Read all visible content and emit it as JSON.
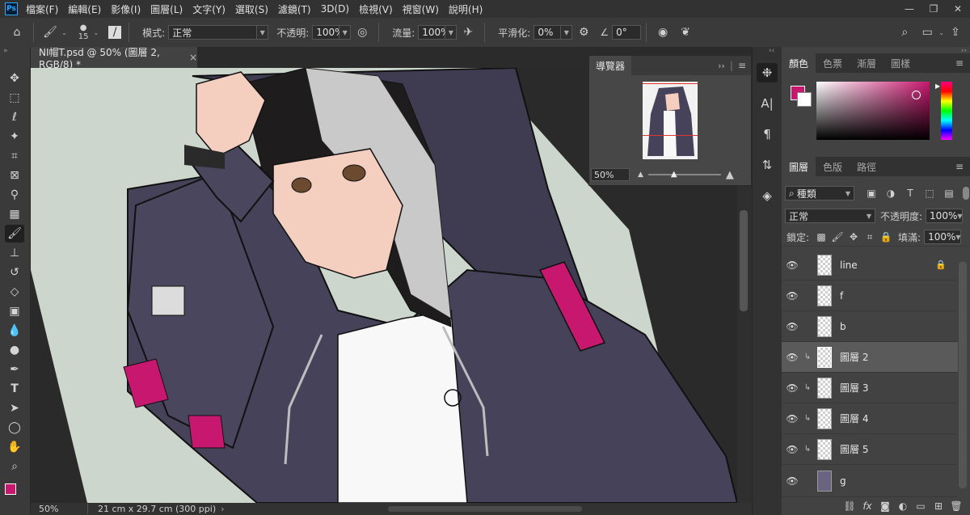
{
  "menu": {
    "app_badge": "Ps",
    "items": [
      "檔案(F)",
      "編輯(E)",
      "影像(I)",
      "圖層(L)",
      "文字(Y)",
      "選取(S)",
      "濾鏡(T)",
      "3D(D)",
      "檢視(V)",
      "視窗(W)",
      "說明(H)"
    ]
  },
  "options": {
    "brush_size": "15",
    "mode_label": "模式:",
    "mode_value": "正常",
    "opacity_label": "不透明:",
    "opacity_value": "100%",
    "flow_label": "流量:",
    "flow_value": "100%",
    "smoothing_label": "平滑化:",
    "smoothing_value": "0%",
    "angle_value": "0°"
  },
  "document": {
    "tab_title": "NI帽T.psd @ 50% (圖層 2, RGB/8) *",
    "zoom": "50%",
    "doc_info": "21 cm x 29.7 cm (300 ppi)"
  },
  "navigator": {
    "title": "導覽器",
    "zoom": "50%"
  },
  "color_panel": {
    "tabs": [
      "顏色",
      "色票",
      "漸層",
      "圖樣"
    ],
    "foreground": "#c8176f",
    "background": "#ffffff"
  },
  "layers_panel": {
    "tabs": [
      "圖層",
      "色版",
      "路徑"
    ],
    "filter_kind": "種類",
    "blend_mode": "正常",
    "opacity_label": "不透明度:",
    "opacity_value": "100%",
    "lock_label": "鎖定:",
    "fill_label": "填滿:",
    "fill_value": "100%",
    "layers": [
      {
        "name": "line",
        "locked": true,
        "clipped": false,
        "selected": false
      },
      {
        "name": "f",
        "locked": false,
        "clipped": false,
        "selected": false
      },
      {
        "name": "b",
        "locked": false,
        "clipped": false,
        "selected": false
      },
      {
        "name": "圖層 2",
        "locked": false,
        "clipped": true,
        "selected": true
      },
      {
        "name": "圖層 3",
        "locked": false,
        "clipped": true,
        "selected": false
      },
      {
        "name": "圖層 4",
        "locked": false,
        "clipped": true,
        "selected": false
      },
      {
        "name": "圖層 5",
        "locked": false,
        "clipped": true,
        "selected": false
      },
      {
        "name": "g",
        "locked": false,
        "clipped": false,
        "selected": false
      }
    ]
  }
}
